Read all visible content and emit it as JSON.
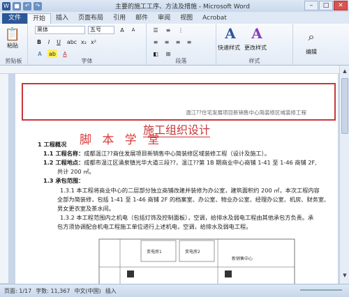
{
  "window": {
    "title": "主要的施工工序、方法及措施 - Microsoft Word",
    "controls": [
      "–",
      "□",
      "✕"
    ]
  },
  "tabs": [
    "文件",
    "开始",
    "插入",
    "页面布局",
    "引用",
    "邮件",
    "审阅",
    "视图",
    "Acrobat"
  ],
  "ribbon": {
    "clipboard": {
      "paste_label": "粘贴",
      "group": "剪贴板"
    },
    "font": {
      "name": "黑体",
      "size": "五号",
      "bold": "B",
      "italic": "I",
      "underline": "U",
      "group": "字体"
    },
    "paragraph": {
      "group": "段落"
    },
    "styles": {
      "quick": "快速样式",
      "change": "更改样式",
      "group": "样式"
    },
    "editing": {
      "label": "编辑"
    }
  },
  "document": {
    "header_text": "温江??住宅发展项目新销售中心简装修区域装修工程",
    "title": "施工组织设计",
    "watermark": "脚 本 学 堂",
    "sec1": "1   工程概况",
    "s11_label": "1.1   工程名称：",
    "s11_text": "成都温江??商住发展项目新销售中心简装修区域装修工程（设计及施工）。",
    "s12_label": "1.2   工程地点：",
    "s12_text": "成都市温江区涌泉镇光华大道三段??，温江??第 1B 期商业中心商铺 1-41 至 1-46 商铺 2F,",
    "s12_cont": "共计 200 ㎡。",
    "s13_label": "1.3   承包范围：",
    "s131_a": "1.3.1  本工程将商业中心的二层部分独立商铺改建并装修为办公室，建筑面积约 200 ㎡，本次工程内容",
    "s131_b": "全部为简装修，包括 1-41 至 1-46 商铺 2F 的档案室、办公室、物业办公室、经理办公室、机房、财务室、",
    "s131_c": "男女更衣室及茶水间。",
    "s132_a": "1.3.2  本工程范围内之机电（包括灯饰及控制面板），空调，给排水及弱电工程由其他承包方负责。承",
    "s132_b": "包方须协调配合机电工程施工单位进行上述机电，空调，给排水及弱电工程。",
    "plan_label1": "变电房1",
    "plan_label2": "变电房2",
    "plan_label3": "新销售中心"
  },
  "status": {
    "page": "页面: 1/17",
    "words": "字数: 11,367",
    "lang": "中文(中国)",
    "mode": "插入"
  }
}
